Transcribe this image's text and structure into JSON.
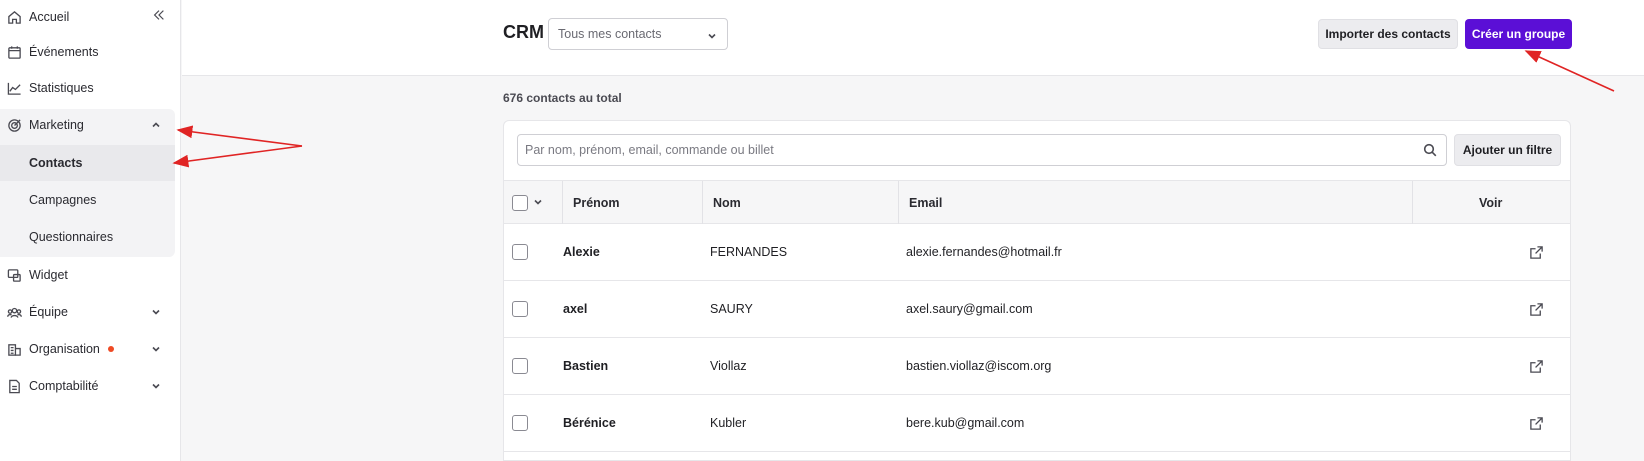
{
  "sidebar": {
    "items": [
      {
        "label": "Accueil",
        "icon": "home-icon"
      },
      {
        "label": "Événements",
        "icon": "calendar-icon"
      },
      {
        "label": "Statistiques",
        "icon": "chart-line-icon"
      },
      {
        "label": "Marketing",
        "icon": "target-icon"
      },
      {
        "label": "Widget",
        "icon": "widget-icon"
      },
      {
        "label": "Équipe",
        "icon": "team-icon"
      },
      {
        "label": "Organisation",
        "icon": "building-icon"
      },
      {
        "label": "Comptabilité",
        "icon": "document-icon"
      }
    ],
    "marketing_subitems": [
      {
        "label": "Contacts",
        "active": true
      },
      {
        "label": "Campagnes",
        "active": false
      },
      {
        "label": "Questionnaires",
        "active": false
      }
    ]
  },
  "header": {
    "title": "CRM",
    "select_value": "Tous mes contacts",
    "import_label": "Importer des contacts",
    "create_group_label": "Créer un groupe"
  },
  "main": {
    "total": "676 contacts au total",
    "search_placeholder": "Par nom, prénom, email, commande ou billet",
    "add_filter_label": "Ajouter un filtre",
    "columns": [
      "Prénom",
      "Nom",
      "Email",
      "Voir"
    ],
    "rows": [
      {
        "prenom": "Alexie",
        "nom": "FERNANDES",
        "email": "alexie.fernandes@hotmail.fr"
      },
      {
        "prenom": "axel",
        "nom": "SAURY",
        "email": "axel.saury@gmail.com"
      },
      {
        "prenom": "Bastien",
        "nom": "Viollaz",
        "email": "bastien.viollaz@iscom.org"
      },
      {
        "prenom": "Bérénice",
        "nom": "Kubler",
        "email": "bere.kub@gmail.com"
      }
    ]
  },
  "colors": {
    "primary": "#5b0fd6",
    "notification_dot": "#ef4a24",
    "annotation_arrow": "#e02424"
  }
}
